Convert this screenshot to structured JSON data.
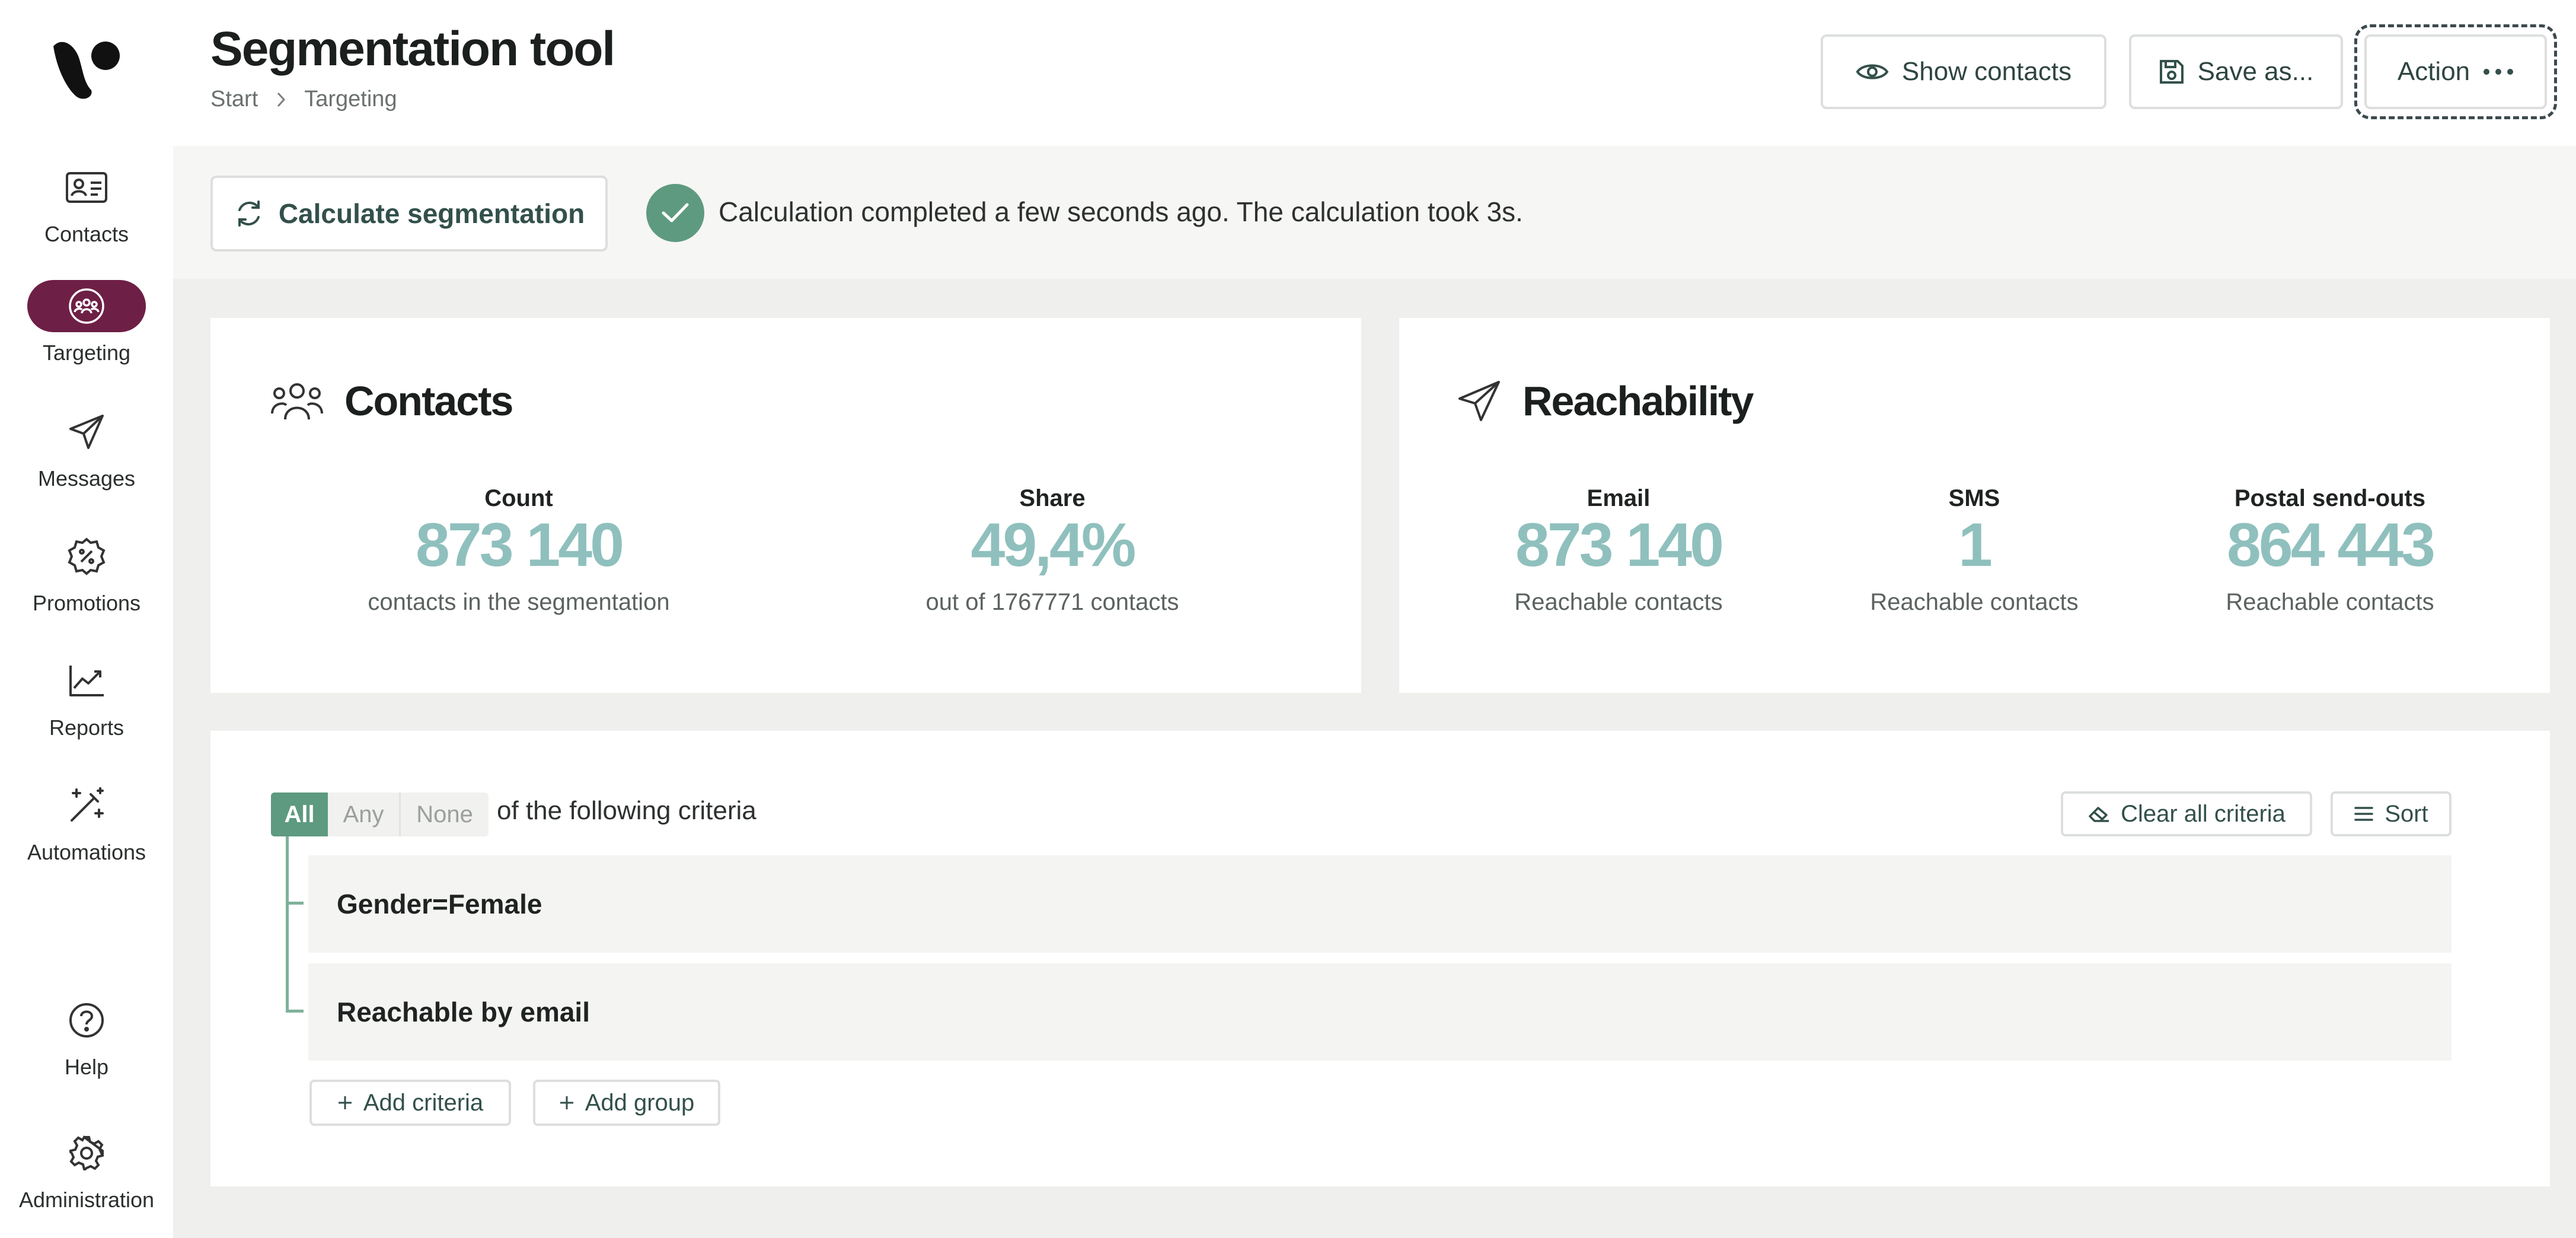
{
  "app": {
    "title": "Segmentation tool"
  },
  "breadcrumb": [
    "Start",
    "Targeting"
  ],
  "header_buttons": {
    "show_contacts": "Show contacts",
    "save_as": "Save as...",
    "action": "Action"
  },
  "sidebar": {
    "items": [
      {
        "label": "Contacts",
        "icon": "contact-card-icon",
        "active": false
      },
      {
        "label": "Targeting",
        "icon": "audience-icon",
        "active": true
      },
      {
        "label": "Messages",
        "icon": "paper-plane-icon",
        "active": false
      },
      {
        "label": "Promotions",
        "icon": "discount-badge-icon",
        "active": false
      },
      {
        "label": "Reports",
        "icon": "trend-chart-icon",
        "active": false
      },
      {
        "label": "Automations",
        "icon": "magic-wand-icon",
        "active": false
      },
      {
        "label": "Help",
        "icon": "help-icon",
        "active": false
      },
      {
        "label": "Administration",
        "icon": "gear-icon",
        "active": false
      }
    ]
  },
  "status": {
    "calculate_label": "Calculate segmentation",
    "message": "Calculation completed a few seconds ago. The calculation took 3s."
  },
  "contacts_card": {
    "title": "Contacts",
    "count": {
      "label": "Count",
      "value": "873 140",
      "sub": "contacts in the segmentation"
    },
    "share": {
      "label": "Share",
      "value": "49,4%",
      "sub": "out of 1767771 contacts"
    }
  },
  "reachability_card": {
    "title": "Reachability",
    "email": {
      "label": "Email",
      "value": "873 140",
      "sub": "Reachable contacts"
    },
    "sms": {
      "label": "SMS",
      "value": "1",
      "sub": "Reachable contacts"
    },
    "postal": {
      "label": "Postal send-outs",
      "value": "864 443",
      "sub": "Reachable contacts"
    }
  },
  "criteria": {
    "modes": [
      "All",
      "Any",
      "None"
    ],
    "selected_mode": "All",
    "suffix": "of the following criteria",
    "clear_label": "Clear all criteria",
    "sort_label": "Sort",
    "items": [
      "Gender=Female",
      "Reachable by email"
    ],
    "add_criteria_label": "Add criteria",
    "add_group_label": "Add group"
  },
  "colors": {
    "brand": "#6e1f45",
    "accent": "#5e9a80",
    "stat_value": "#8fc0bd",
    "status_bg": "#f6f6f4",
    "page_bg": "#efefed"
  }
}
